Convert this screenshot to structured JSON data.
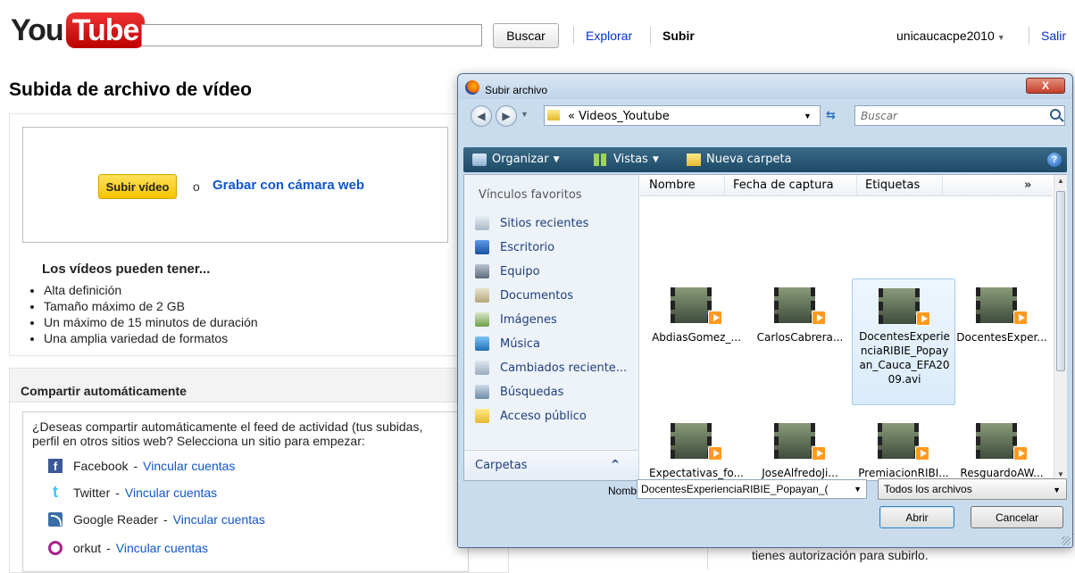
{
  "header": {
    "logo_you": "You",
    "logo_tube": "Tube",
    "search_value": "",
    "search_button": "Buscar",
    "explore_link": "Explorar",
    "upload_link": "Subir",
    "username": "unicaucacpe2010",
    "logout": "Salir"
  },
  "page_title": "Subida de archivo de vídeo",
  "upload": {
    "button": "Subir vídeo",
    "or": "o",
    "webcam_link": "Grabar con cámara web",
    "features_title": "Los vídeos pueden tener...",
    "features": [
      "Alta definición",
      "Tamaño máximo de 2 GB",
      "Un máximo de 15 minutos de duración",
      "Una amplia variedad de formatos"
    ]
  },
  "share": {
    "title": "Compartir automáticamente",
    "description_line1": "¿Deseas compartir automáticamente el feed de actividad (tus subidas,",
    "description_line2": "perfil en otros sitios web? Selecciona un sitio para empezar:",
    "sites": [
      {
        "name": "Facebook",
        "link": "Vincular cuentas",
        "icon": "facebook-icon"
      },
      {
        "name": "Twitter",
        "link": "Vincular cuentas",
        "icon": "twitter-icon"
      },
      {
        "name": "Google Reader",
        "link": "Vincular cuentas",
        "icon": "rss-icon"
      },
      {
        "name": "orkut",
        "link": "Vincular cuentas",
        "icon": "orkut-icon"
      }
    ],
    "separator": "-"
  },
  "right_panel_text": "tienes autorización para subirlo.",
  "dialog": {
    "title": "Subir archivo",
    "close": "X",
    "address_path": "« Videos_Youtube",
    "search_placeholder": "Buscar",
    "toolbar": {
      "organize": "Organizar",
      "views": "Vistas",
      "new_folder": "Nueva carpeta",
      "help": "?"
    },
    "favorites_header": "Vínculos favoritos",
    "favorites": [
      {
        "label": "Sitios recientes",
        "icon": "recent-places-icon"
      },
      {
        "label": "Escritorio",
        "icon": "desktop-icon"
      },
      {
        "label": "Equipo",
        "icon": "computer-icon"
      },
      {
        "label": "Documentos",
        "icon": "documents-icon"
      },
      {
        "label": "Imágenes",
        "icon": "pictures-icon"
      },
      {
        "label": "Música",
        "icon": "music-icon"
      },
      {
        "label": "Cambiados reciente...",
        "icon": "recently-changed-icon"
      },
      {
        "label": "Búsquedas",
        "icon": "searches-icon"
      },
      {
        "label": "Acceso público",
        "icon": "public-folder-icon"
      }
    ],
    "folders_label": "Carpetas",
    "columns": [
      "Nombre",
      "Fecha de captura",
      "Etiquetas"
    ],
    "columns_more": "»",
    "files": [
      {
        "name": "AbdiasGomez_...",
        "selected": false
      },
      {
        "name": "CarlosCabrera...",
        "selected": false
      },
      {
        "name": "DocentesExperie\nnciaRIBIE_Popay\nan_Cauca_EFA20\n09.avi",
        "selected": true
      },
      {
        "name": "DocentesExper...",
        "selected": false
      },
      {
        "name": "Expectativas_fo...",
        "selected": false
      },
      {
        "name": "JoseAlfredoJi...",
        "selected": false
      },
      {
        "name": "PremiacionRIBI...",
        "selected": false
      },
      {
        "name": "ResguardoAW...",
        "selected": false
      }
    ],
    "filename_label": "Nombre:",
    "filename_value": "DocentesExperienciaRIBIE_Popayan_(",
    "filetype_value": "Todos los archivos",
    "open_button": "Abrir",
    "cancel_button": "Cancelar"
  },
  "colors": {
    "youtube_red": "#cc181e",
    "link_blue": "#0033cc",
    "upload_yellow": "#f5c400",
    "toolbar_blue": "#2a5a78"
  }
}
